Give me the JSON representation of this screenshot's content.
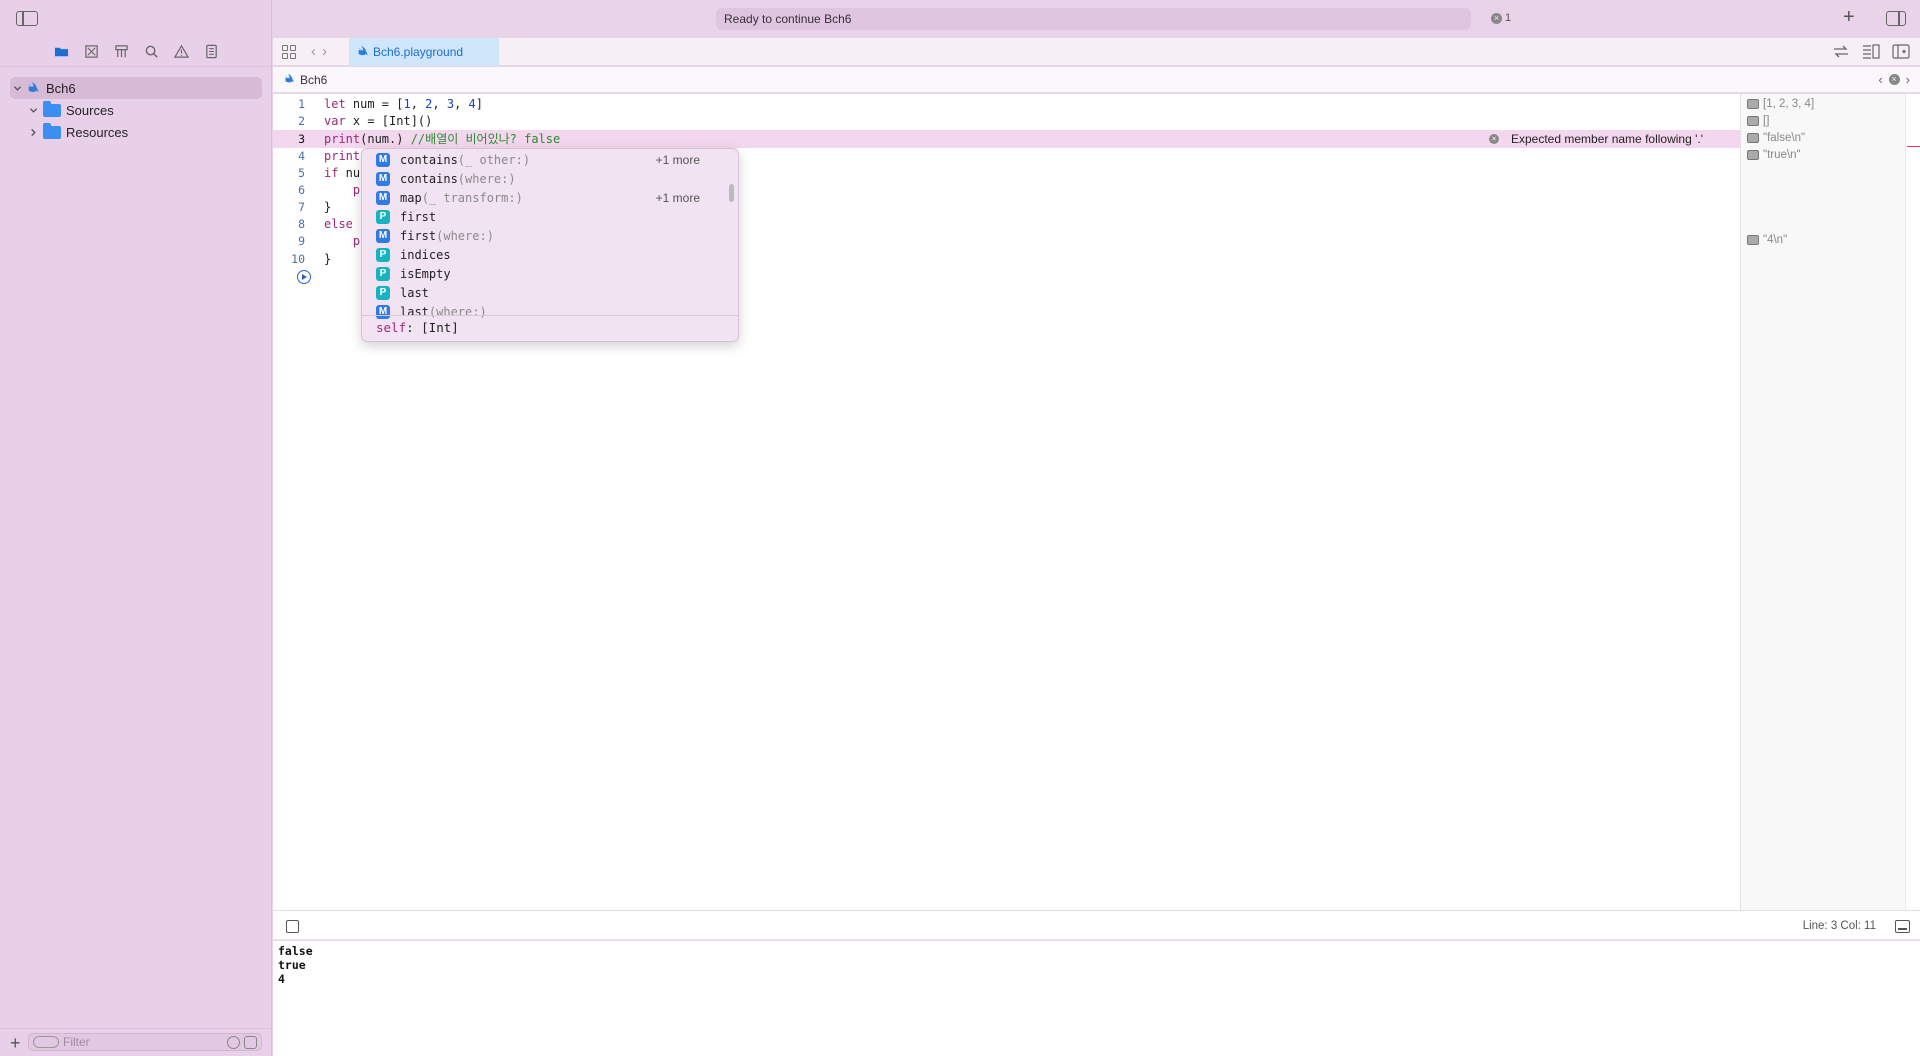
{
  "toolbar": {
    "status": "Ready to continue Bch6",
    "error_count": "1"
  },
  "sidebar": {
    "project": "Bch6",
    "items": [
      {
        "label": "Sources"
      },
      {
        "label": "Resources"
      }
    ],
    "filter_placeholder": "Filter"
  },
  "tab": {
    "file": "Bch6.playground"
  },
  "jumpbar": {
    "crumb": "Bch6"
  },
  "editor": {
    "line_numbers": [
      "1",
      "2",
      "3",
      "4",
      "5",
      "6",
      "7",
      "8",
      "9",
      "10"
    ],
    "error_message": "Expected member name following '.'"
  },
  "code": {
    "l1_kw": "let",
    "l1_id": " num = [",
    "l1_n1": "1",
    "l1_s1": ", ",
    "l1_n2": "2",
    "l1_s2": ", ",
    "l1_n3": "3",
    "l1_s3": ", ",
    "l1_n4": "4",
    "l1_end": "]",
    "l2_kw": "var",
    "l2_rest": " x = [Int]()",
    "l3_fn": "print",
    "l3_rest": "(num.) ",
    "l3_cm": "//배열이 비어있나? false",
    "l4": "print",
    "l5_kw": "if",
    "l5_rest": " nu",
    "l6": "    p",
    "l7": "}",
    "l8_kw": "else",
    "l9": "    p",
    "l10": "}"
  },
  "completion": {
    "items": [
      {
        "kind": "M",
        "name": "contains",
        "args": "(_ other:)",
        "more": "+1 more"
      },
      {
        "kind": "M",
        "name": "contains",
        "args": "(where:)",
        "more": ""
      },
      {
        "kind": "M",
        "name": "map",
        "args": "(_ transform:)",
        "more": "+1 more"
      },
      {
        "kind": "P",
        "name": "first",
        "args": "",
        "more": ""
      },
      {
        "kind": "M",
        "name": "first",
        "args": "(where:)",
        "more": ""
      },
      {
        "kind": "P",
        "name": "indices",
        "args": "",
        "more": ""
      },
      {
        "kind": "P",
        "name": "isEmpty",
        "args": "",
        "more": ""
      },
      {
        "kind": "P",
        "name": "last",
        "args": "",
        "more": ""
      },
      {
        "kind": "M",
        "name": "last",
        "args": "(where:)",
        "more": ""
      }
    ],
    "footer_kw": "self",
    "footer_type": ": [Int]"
  },
  "results": {
    "r1": "[1, 2, 3, 4]",
    "r2": "[]",
    "r3": "\"false\\n\"",
    "r4": "\"true\\n\"",
    "r9": "\"4\\n\""
  },
  "debug": {
    "cursor": "Line: 3  Col: 11"
  },
  "console": {
    "lines": [
      "false",
      "true",
      "4"
    ]
  },
  "colors": {
    "sidebar_bg": "#e9d0e9",
    "accent": "#1a6fd6",
    "keyword": "#a0287a",
    "number": "#1a3fc6",
    "comment": "#2d8a2d"
  }
}
